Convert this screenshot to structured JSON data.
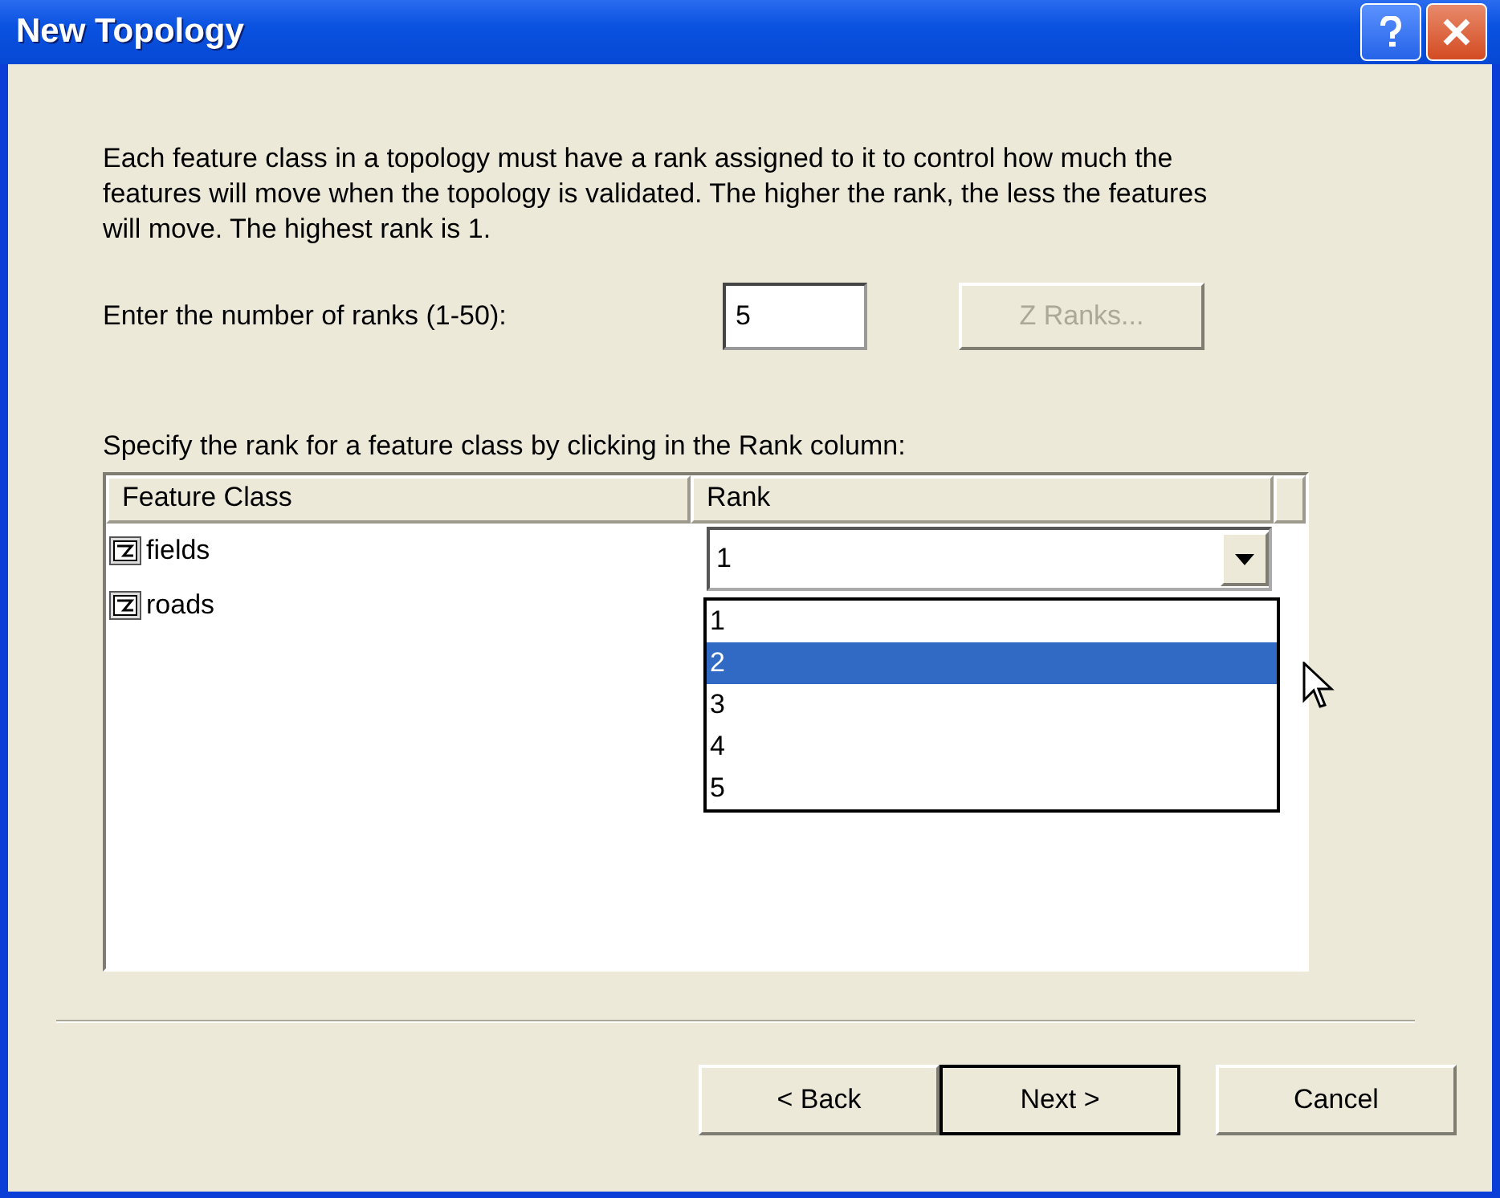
{
  "window": {
    "title": "New Topology"
  },
  "intro": "Each feature class in a topology must have a rank assigned to it to control how much the features will move when the topology is validated. The higher the rank, the less the features will move. The highest rank is 1.",
  "ranks": {
    "label": "Enter the number of ranks  (1-50):",
    "value": "5"
  },
  "z_ranks_button": {
    "label": "Z Ranks...",
    "disabled": true
  },
  "table_label": "Specify the rank for a feature class by clicking in the Rank column:",
  "table": {
    "columns": [
      "Feature Class",
      "Rank"
    ],
    "rows": [
      {
        "name": "fields",
        "rank": "1",
        "editing": true
      },
      {
        "name": "roads",
        "editing": false
      }
    ]
  },
  "rank_dropdown": {
    "options": [
      {
        "label": "1",
        "selected": false
      },
      {
        "label": "2",
        "selected": true
      },
      {
        "label": "3",
        "selected": false
      },
      {
        "label": "4",
        "selected": false
      },
      {
        "label": "5",
        "selected": false
      }
    ]
  },
  "buttons": [
    {
      "label": "< Back",
      "default": false
    },
    {
      "label": "Next >",
      "default": true
    },
    {
      "label": "Cancel",
      "default": false
    }
  ]
}
